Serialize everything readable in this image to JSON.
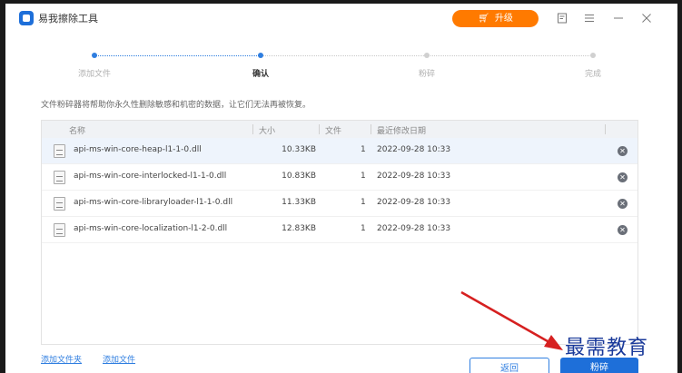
{
  "app": {
    "title": "易我擦除工具"
  },
  "titlebar": {
    "upgrade_label": "升级",
    "icons": [
      "cart-icon",
      "feedback-icon",
      "menu-icon",
      "minimize-icon",
      "close-icon"
    ]
  },
  "stepper": {
    "steps": [
      {
        "label": "添加文件",
        "state": "done"
      },
      {
        "label": "确认",
        "state": "current"
      },
      {
        "label": "粉碎",
        "state": "pending"
      },
      {
        "label": "完成",
        "state": "pending"
      }
    ]
  },
  "description": "文件粉碎器将帮助你永久性删除敏感和机密的数据，让它们无法再被恢复。",
  "table": {
    "columns": [
      "名称",
      "大小",
      "文件",
      "最近修改日期"
    ],
    "rows": [
      {
        "name": "api-ms-win-core-heap-l1-1-0.dll",
        "size": "10.33KB",
        "count": "1",
        "date": "2022-09-28 10:33",
        "selected": true
      },
      {
        "name": "api-ms-win-core-interlocked-l1-1-0.dll",
        "size": "10.83KB",
        "count": "1",
        "date": "2022-09-28 10:33",
        "selected": false
      },
      {
        "name": "api-ms-win-core-libraryloader-l1-1-0.dll",
        "size": "11.33KB",
        "count": "1",
        "date": "2022-09-28 10:33",
        "selected": false
      },
      {
        "name": "api-ms-win-core-localization-l1-2-0.dll",
        "size": "12.83KB",
        "count": "1",
        "date": "2022-09-28 10:33",
        "selected": false
      }
    ]
  },
  "footer": {
    "add_folder": "添加文件夹",
    "add_file": "添加文件",
    "back": "返回",
    "shred": "粉碎"
  },
  "watermark": "最需教育",
  "colors": {
    "accent": "#1e6fd9",
    "upgrade": "#ff7a00",
    "arrow": "#d62020"
  }
}
